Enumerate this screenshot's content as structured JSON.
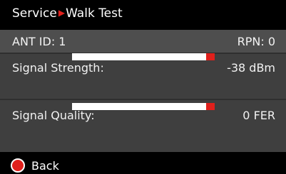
{
  "header": {
    "section": "Service",
    "separator_icon": "triangle-right-icon",
    "page": "Walk Test"
  },
  "ant_row": {
    "ant_id": "ANT ID: 1",
    "rpn": "RPN: 0"
  },
  "signal_strength": {
    "label": "Signal Strength:",
    "value": "-38 dBm",
    "level": 1.0
  },
  "signal_quality": {
    "label": "Signal Quality:",
    "value": "0 FER",
    "level": 1.0
  },
  "footer": {
    "back_icon": "red-circle-icon",
    "back_label": "Back"
  },
  "colors": {
    "accent_red": "#e0201c",
    "panel": "#3f3f3f",
    "row_highlight": "#4e4e4e",
    "background": "#000000"
  }
}
